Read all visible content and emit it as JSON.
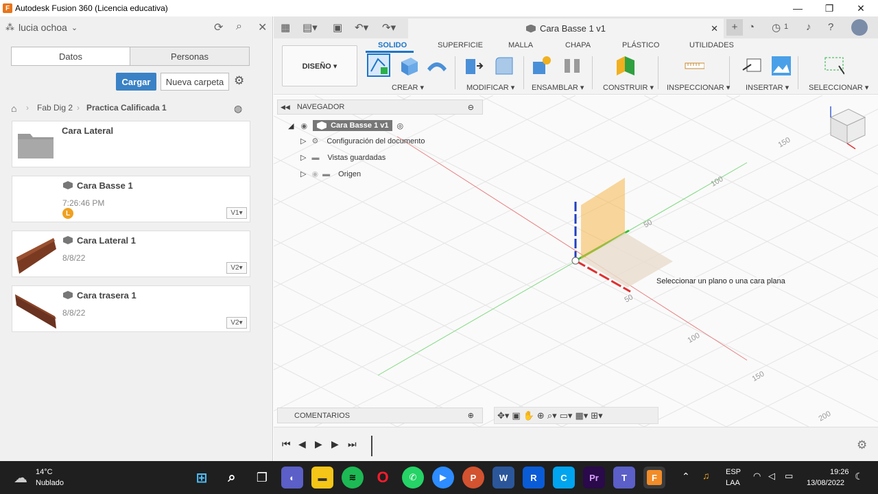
{
  "window": {
    "title": "Autodesk Fusion 360 (Licencia educativa)",
    "min": "—",
    "max": "❐",
    "close": "✕"
  },
  "left_panel": {
    "user": "lucia ochoa",
    "tabs": [
      "Datos",
      "Personas"
    ],
    "upload_label": "Cargar",
    "new_folder_label": "Nueva carpeta",
    "breadcrumb": [
      "Fab Dig 2",
      "Practica Calificada 1"
    ],
    "items": [
      {
        "name": "Cara Lateral",
        "sub": "",
        "version": "",
        "kind": "folder"
      },
      {
        "name": "Cara Basse 1",
        "sub": "7:26:46 PM",
        "version": "V1▾",
        "badge": "L",
        "kind": "design"
      },
      {
        "name": "Cara Lateral 1",
        "sub": "8/8/22",
        "version": "V2▾",
        "kind": "design"
      },
      {
        "name": "Cara trasera 1",
        "sub": "8/8/22",
        "version": "V2▾",
        "kind": "design"
      }
    ]
  },
  "document_tab": {
    "title": "Cara Basse 1 v1"
  },
  "notifications_count": "1",
  "ribbon": {
    "workspace": "DISEÑO ▾",
    "tabs": [
      "SOLIDO",
      "SUPERFICIE",
      "MALLA",
      "CHAPA",
      "PLÁSTICO",
      "UTILIDADES"
    ],
    "active_tab": "SOLIDO",
    "groups": [
      "CREAR ▾",
      "MODIFICAR ▾",
      "ENSAMBLAR ▾",
      "CONSTRUIR ▾",
      "INSPECCIONAR ▾",
      "INSERTAR ▾",
      "SELECCIONAR ▾"
    ]
  },
  "browser": {
    "title": "NAVEGADOR",
    "root": "Cara Basse 1 v1",
    "nodes": [
      "Configuración del documento",
      "Vistas guardadas",
      "Origen"
    ]
  },
  "viewport": {
    "tooltip": "Seleccionar un plano o una cara plana",
    "axis_labels": [
      "150",
      "100",
      "50",
      "50",
      "100",
      "150",
      "200"
    ],
    "colors": {
      "x_axis": "#e03030",
      "y_axis": "#30c030",
      "z_axis": "#2040c0",
      "plane": "#f5b74a"
    }
  },
  "comments": {
    "label": "COMENTARIOS"
  },
  "taskbar": {
    "weather_temp": "14°C",
    "weather_desc": "Nublado",
    "lang_1": "ESP",
    "lang_2": "LAA",
    "time": "19:26",
    "date": "13/08/2022"
  }
}
